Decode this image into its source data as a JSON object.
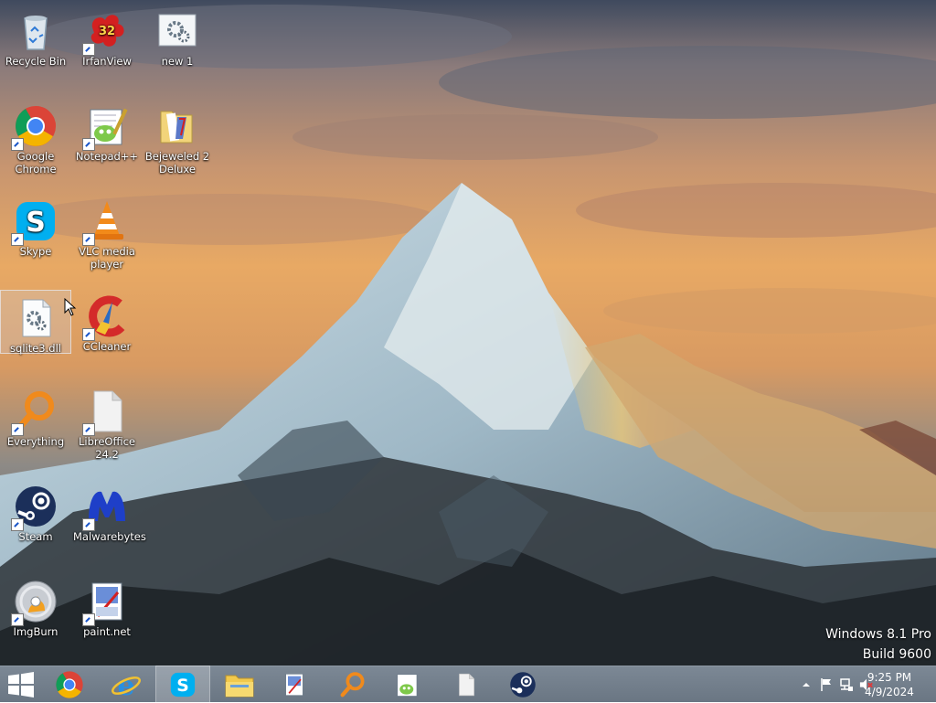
{
  "desktop": {
    "icons": [
      {
        "name": "recycle-bin",
        "label": "Recycle Bin",
        "icon": "recycle-bin-icon"
      },
      {
        "name": "irfanview",
        "label": "IrfanView",
        "icon": "irfanview-icon",
        "badge": "32"
      },
      {
        "name": "new1",
        "label": "new 1",
        "icon": "settings-file-icon"
      },
      {
        "name": "google-chrome",
        "label": "Google Chrome",
        "icon": "chrome-icon"
      },
      {
        "name": "notepadpp",
        "label": "Notepad++",
        "icon": "notepadpp-icon"
      },
      {
        "name": "bejeweled",
        "label": "Bejeweled 2 Deluxe",
        "icon": "folder-icon"
      },
      {
        "name": "skype",
        "label": "Skype",
        "icon": "skype-icon"
      },
      {
        "name": "vlc",
        "label": "VLC media player",
        "icon": "vlc-icon"
      },
      {
        "name": "sqlite3",
        "label": "sqlite3.dll",
        "icon": "dll-file-icon",
        "selected": true
      },
      {
        "name": "ccleaner",
        "label": "CCleaner",
        "icon": "ccleaner-icon"
      },
      {
        "name": "everything",
        "label": "Everything",
        "icon": "search-magnifier-icon"
      },
      {
        "name": "libreoffice",
        "label": "LibreOffice 24.2",
        "icon": "libreoffice-icon"
      },
      {
        "name": "steam",
        "label": "Steam",
        "icon": "steam-icon"
      },
      {
        "name": "malwarebytes",
        "label": "Malwarebytes",
        "icon": "malwarebytes-icon"
      },
      {
        "name": "imgburn",
        "label": "ImgBurn",
        "icon": "disc-icon"
      },
      {
        "name": "paintnet",
        "label": "paint.net",
        "icon": "paintnet-icon"
      }
    ],
    "watermark": {
      "line1": "Windows 8.1 Pro",
      "line2": "Build 9600"
    }
  },
  "taskbar": {
    "items": [
      {
        "name": "start",
        "icon": "windows-logo-icon"
      },
      {
        "name": "chrome",
        "icon": "chrome-icon"
      },
      {
        "name": "internet-explorer",
        "icon": "ie-icon"
      },
      {
        "name": "skype",
        "icon": "skype-icon",
        "active": true
      },
      {
        "name": "file-explorer",
        "icon": "file-explorer-icon"
      },
      {
        "name": "paintnet",
        "icon": "paintnet-icon"
      },
      {
        "name": "everything",
        "icon": "search-magnifier-icon"
      },
      {
        "name": "notepadpp",
        "icon": "notepadpp-icon"
      },
      {
        "name": "libreoffice",
        "icon": "libreoffice-icon"
      },
      {
        "name": "steam",
        "icon": "steam-icon"
      }
    ],
    "tray": {
      "icons": [
        "chevron-up-icon",
        "flag-icon",
        "network-icon",
        "volume-muted-icon"
      ],
      "time": "9:25 PM",
      "date": "4/9/2024"
    }
  },
  "colors": {
    "taskbar": "#6a7683",
    "accent_orange": "#f08a1c",
    "skype_blue": "#00aff0"
  }
}
